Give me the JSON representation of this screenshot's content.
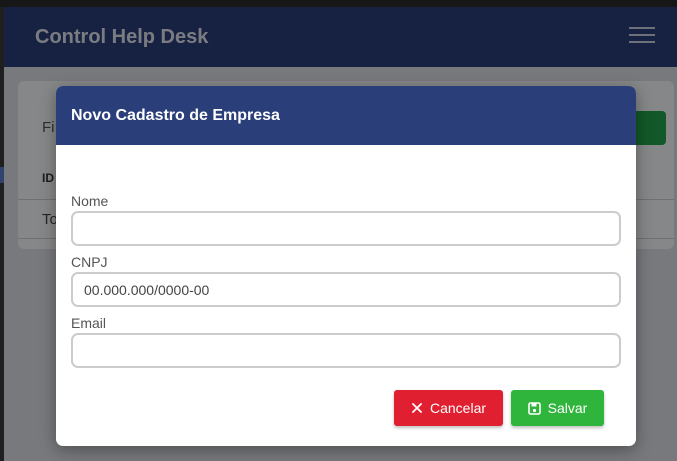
{
  "app": {
    "title": "Control Help Desk",
    "menu_icon": "hamburger-menu-icon"
  },
  "background_card": {
    "filter_label": "Fi",
    "id_header": "ID",
    "row_text": "To"
  },
  "modal": {
    "title": "Novo Cadastro de Empresa",
    "fields": {
      "nome": {
        "label": "Nome",
        "value": "",
        "placeholder": ""
      },
      "cnpj": {
        "label": "CNPJ",
        "value": "",
        "placeholder": "00.000.000/0000-00"
      },
      "email": {
        "label": "Email",
        "value": "",
        "placeholder": ""
      }
    },
    "buttons": {
      "cancel": {
        "label": "Cancelar",
        "icon": "close-icon",
        "color": "#e02030"
      },
      "save": {
        "label": "Salvar",
        "icon": "save-icon",
        "color": "#2fb43c"
      }
    }
  },
  "colors": {
    "header": "#2a3f7a",
    "overlay": "rgba(0,0,0,0.45)"
  }
}
